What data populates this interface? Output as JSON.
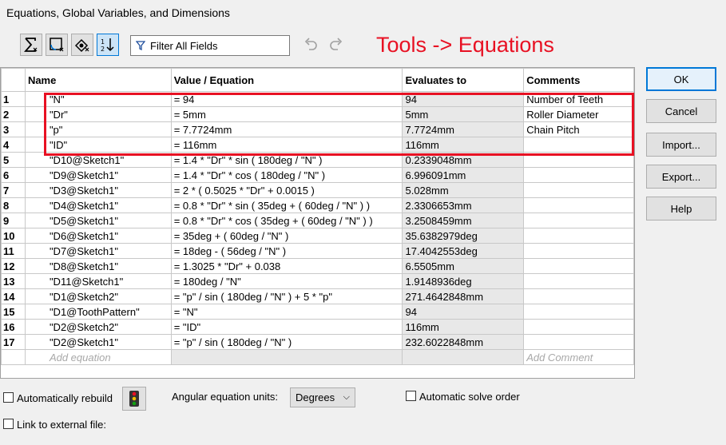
{
  "window": {
    "title": "Equations, Global Variables, and Dimensions"
  },
  "toolbar": {
    "filter_label": "Filter All Fields",
    "annotation": "Tools -> Equations",
    "buttons": [
      "equation-view-icon",
      "sketch-equation-view-icon",
      "dimension-view-icon",
      "ordered-view-icon"
    ]
  },
  "table": {
    "headers": {
      "name": "Name",
      "value": "Value / Equation",
      "evaluates": "Evaluates to",
      "comments": "Comments"
    },
    "rows": [
      {
        "num": "1",
        "name": "\"N\"",
        "value": "= 94",
        "evaluates": "94",
        "comment": "Number of Teeth"
      },
      {
        "num": "2",
        "name": "\"Dr\"",
        "value": "= 5mm",
        "evaluates": "5mm",
        "comment": "Roller Diameter"
      },
      {
        "num": "3",
        "name": "\"p\"",
        "value": "= 7.7724mm",
        "evaluates": "7.7724mm",
        "comment": "Chain Pitch"
      },
      {
        "num": "4",
        "name": "\"ID\"",
        "value": "= 116mm",
        "evaluates": "116mm",
        "comment": ""
      },
      {
        "num": "5",
        "name": "\"D10@Sketch1\"",
        "value": "= 1.4 * \"Dr\" * sin ( 180deg / \"N\" )",
        "evaluates": "0.2339048mm",
        "comment": ""
      },
      {
        "num": "6",
        "name": "\"D9@Sketch1\"",
        "value": "= 1.4 * \"Dr\" * cos ( 180deg / \"N\" )",
        "evaluates": "6.996091mm",
        "comment": ""
      },
      {
        "num": "7",
        "name": "\"D3@Sketch1\"",
        "value": "= 2 * ( 0.5025 * \"Dr\" + 0.0015 )",
        "evaluates": "5.028mm",
        "comment": ""
      },
      {
        "num": "8",
        "name": "\"D4@Sketch1\"",
        "value": "= 0.8 * \"Dr\" * sin ( 35deg + ( 60deg / \"N\" ) )",
        "evaluates": "2.3306653mm",
        "comment": ""
      },
      {
        "num": "9",
        "name": "\"D5@Sketch1\"",
        "value": "= 0.8 * \"Dr\" * cos ( 35deg + ( 60deg / \"N\" ) )",
        "evaluates": "3.2508459mm",
        "comment": ""
      },
      {
        "num": "10",
        "name": "\"D6@Sketch1\"",
        "value": "= 35deg + ( 60deg / \"N\" )",
        "evaluates": "35.6382979deg",
        "comment": ""
      },
      {
        "num": "11",
        "name": "\"D7@Sketch1\"",
        "value": "= 18deg - ( 56deg / \"N\" )",
        "evaluates": "17.4042553deg",
        "comment": ""
      },
      {
        "num": "12",
        "name": "\"D8@Sketch1\"",
        "value": "= 1.3025 * \"Dr\" + 0.038",
        "evaluates": "6.5505mm",
        "comment": ""
      },
      {
        "num": "13",
        "name": "\"D11@Sketch1\"",
        "value": "= 180deg / \"N\"",
        "evaluates": "1.9148936deg",
        "comment": ""
      },
      {
        "num": "14",
        "name": "\"D1@Sketch2\"",
        "value": "= \"p\" / sin ( 180deg / \"N\" ) + 5 * \"p\"",
        "evaluates": "271.4642848mm",
        "comment": ""
      },
      {
        "num": "15",
        "name": "\"D1@ToothPattern\"",
        "value": "= \"N\"",
        "evaluates": "94",
        "comment": ""
      },
      {
        "num": "16",
        "name": "\"D2@Sketch2\"",
        "value": "= \"ID\"",
        "evaluates": "116mm",
        "comment": ""
      },
      {
        "num": "17",
        "name": "\"D2@Sketch1\"",
        "value": "= \"p\" / sin ( 180deg / \"N\" )",
        "evaluates": "232.6022848mm",
        "comment": ""
      }
    ],
    "add_equation_placeholder": "Add equation",
    "add_comment_placeholder": "Add Comment"
  },
  "buttons": {
    "ok": "OK",
    "cancel": "Cancel",
    "import": "Import...",
    "export": "Export...",
    "help": "Help"
  },
  "options": {
    "auto_rebuild": "Automatically rebuild",
    "angular_units_label": "Angular equation units:",
    "angular_units_value": "Degrees",
    "auto_solve": "Automatic solve order",
    "link_external": "Link to external file:"
  },
  "colors": {
    "annotation": "#e81123",
    "highlight_box": "#e81123"
  }
}
